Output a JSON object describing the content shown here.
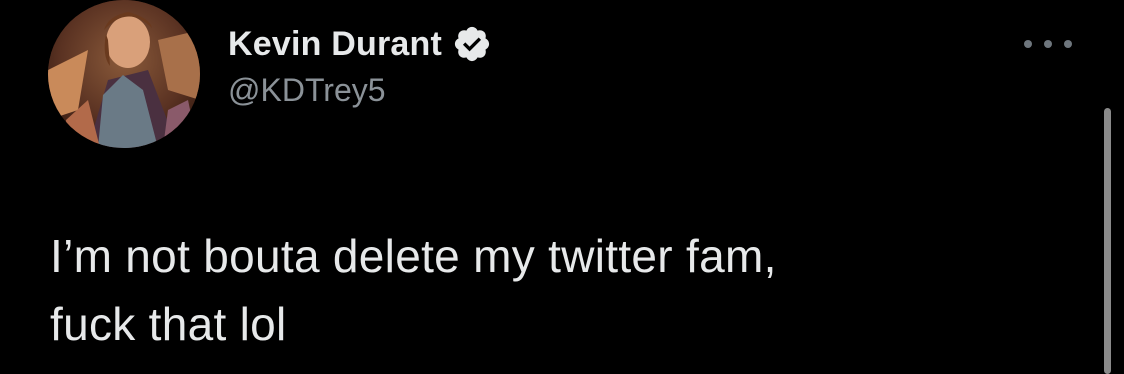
{
  "author": {
    "display_name": "Kevin Durant",
    "handle": "@KDTrey5",
    "verified": true,
    "avatar": "profile-avatar"
  },
  "tweet": {
    "text": "I’m not bouta delete my twitter fam,\nfuck that lol"
  },
  "menu": {
    "icon": "more-options-icon"
  },
  "colors": {
    "background": "#000000",
    "text": "#e7e9ea",
    "handle": "#8b9298",
    "verified_badge": "#e7e9ea"
  }
}
